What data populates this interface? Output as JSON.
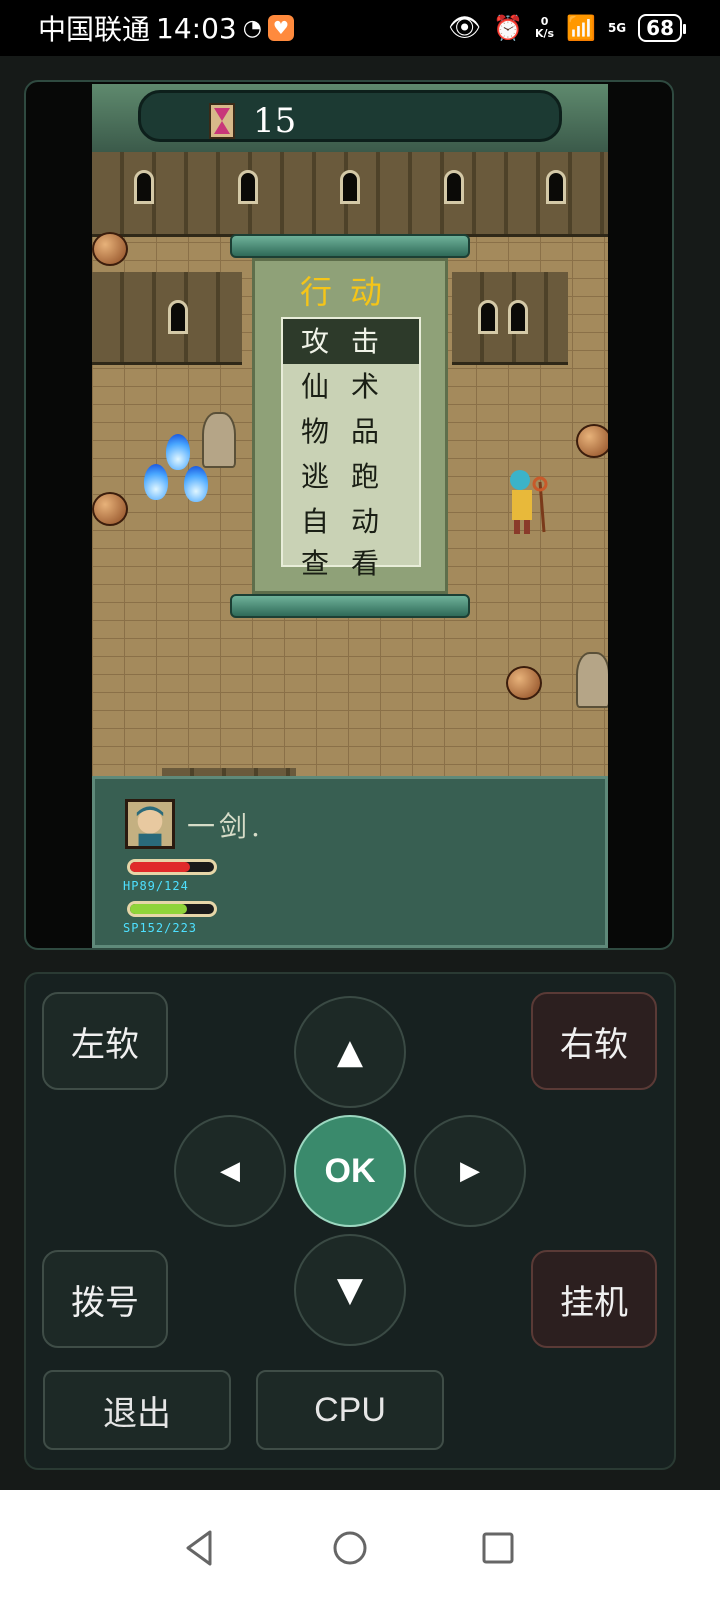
{
  "status_bar": {
    "carrier": "中国联通",
    "time": "14:03",
    "net_speed_value": "0",
    "net_speed_unit": "K/s",
    "network_type": "5G",
    "battery": "68"
  },
  "game": {
    "timer": "15",
    "menu": {
      "title": "行动",
      "items": [
        "攻击",
        "仙术",
        "物品",
        "逃跑",
        "自动",
        "查看"
      ],
      "selected_index": 0
    },
    "dialog": {
      "text": "一剑.",
      "hp_label": "HP89/124",
      "sp_label": "SP152/223",
      "hp": {
        "current": 89,
        "max": 124
      },
      "sp": {
        "current": 152,
        "max": 223
      }
    }
  },
  "controls": {
    "left_soft": "左软",
    "right_soft": "右软",
    "ok": "OK",
    "up": "▲",
    "down": "▼",
    "left": "◀",
    "right": "▶",
    "dial": "拨号",
    "hang_up": "挂机",
    "exit": "退出",
    "cpu": "CPU"
  },
  "colors": {
    "ok_button": "#3a8a6c",
    "hp_bar": "#e02a2a",
    "sp_bar": "#8fd43a",
    "menu_title": "#f5c518"
  }
}
